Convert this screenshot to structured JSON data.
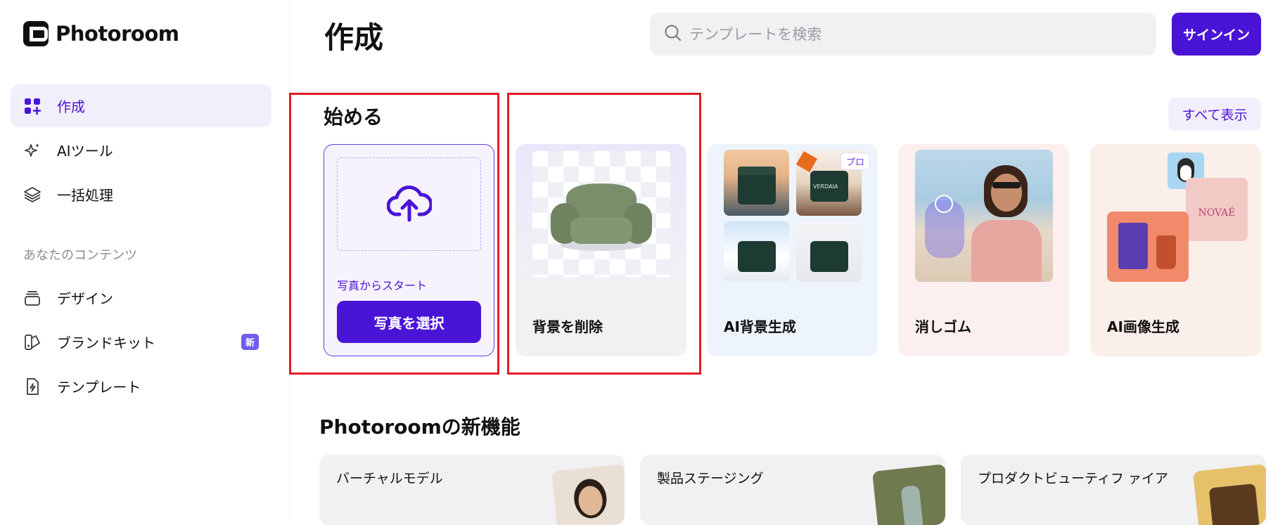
{
  "brand": {
    "name": "Photoroom"
  },
  "sidebar": {
    "items": [
      {
        "label": "作成",
        "icon": "grid-plus-icon"
      },
      {
        "label": "AIツール",
        "icon": "sparkles-icon"
      },
      {
        "label": "一括処理",
        "icon": "layers-icon"
      }
    ],
    "section_label": "あなたのコンテンツ",
    "content_items": [
      {
        "label": "デザイン",
        "icon": "stack-icon"
      },
      {
        "label": "ブランドキット",
        "icon": "brand-kit-icon",
        "badge": "新"
      },
      {
        "label": "テンプレート",
        "icon": "template-bolt-icon"
      }
    ]
  },
  "header": {
    "title": "作成",
    "search_placeholder": "テンプレートを検索",
    "signin_label": "サインイン"
  },
  "start": {
    "title": "始める",
    "show_all": "すべて表示",
    "upload_hint": "写真からスタート",
    "select_button": "写真を選択",
    "tools": [
      {
        "label": "背景を削除"
      },
      {
        "label": "AI背景生成",
        "badge": "プロ",
        "product_text": "VERDAIA"
      },
      {
        "label": "消しゴム"
      },
      {
        "label": "AI画像生成",
        "brand_text": "NOVAÉ"
      }
    ]
  },
  "whats_new": {
    "title": "Photoroomの新機能",
    "cards": [
      {
        "label": "バーチャルモデル"
      },
      {
        "label": "製品ステージング"
      },
      {
        "label": "プロダクトビューティフ ァイア"
      }
    ]
  },
  "colors": {
    "accent": "#4a14d6",
    "highlight": "#e11d26"
  }
}
